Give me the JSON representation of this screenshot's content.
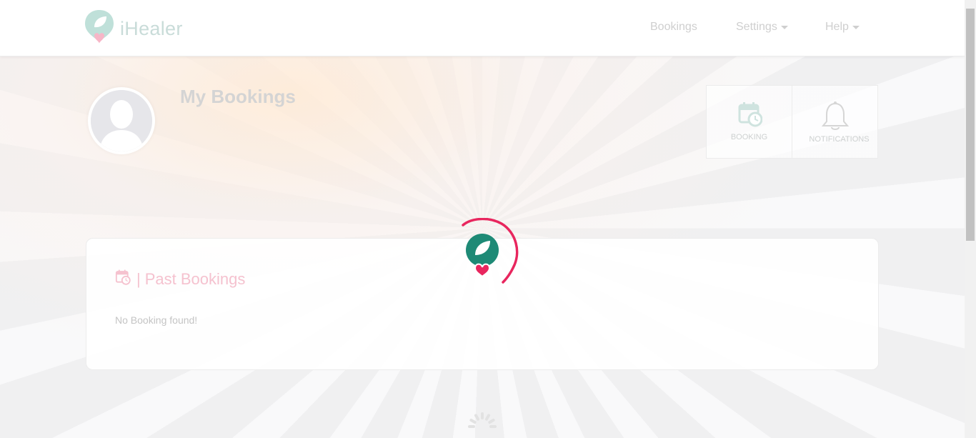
{
  "brand": {
    "name": "iHealer"
  },
  "nav": {
    "bookings": "Bookings",
    "settings": "Settings",
    "help": "Help"
  },
  "profile": {
    "page_title": "My Bookings"
  },
  "tiles": {
    "booking": "BOOKING",
    "notifications": "NOTIFICATIONS"
  },
  "past_bookings": {
    "separator": "|",
    "title": "Past Bookings",
    "empty_message": "No Booking found!"
  },
  "colors": {
    "brand_teal": "#1e8a76",
    "brand_pink": "#e8265e",
    "loader_ring": "#e8265e"
  },
  "icons": {
    "logo": "ihealer-logo-icon",
    "avatar": "user-avatar-icon",
    "booking": "calendar-clock-icon",
    "notifications": "bell-icon",
    "past_bookings": "calendar-clock-icon",
    "loader": "loading-spinner-icon"
  }
}
